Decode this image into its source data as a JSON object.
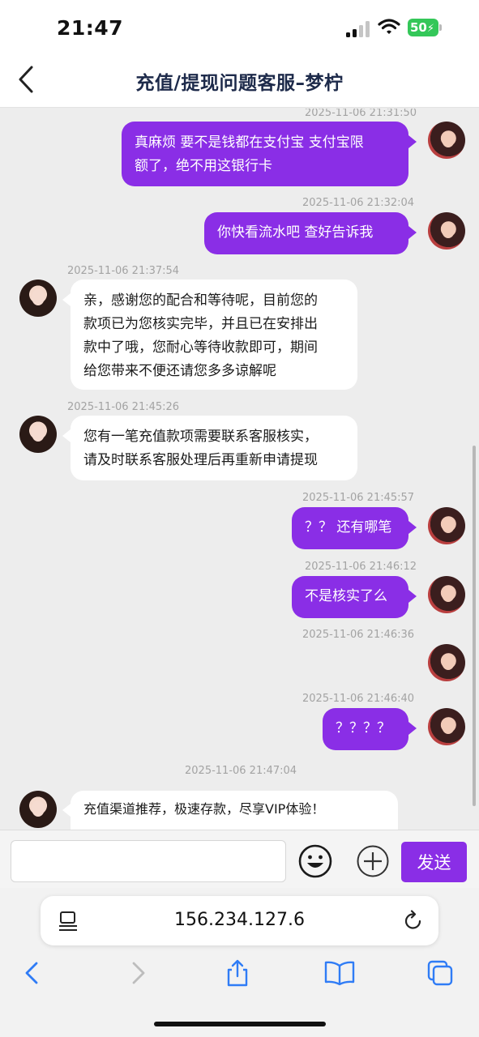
{
  "status_bar": {
    "time": "21:47",
    "battery": "50"
  },
  "header": {
    "title": "充值/提现问题客服–梦柠"
  },
  "colors": {
    "accent": "#8a2ee6",
    "title": "#1d2a4a",
    "battery": "#34c759"
  },
  "messages": [
    {
      "side": "right",
      "time": "2025-11-06 21:31:50",
      "lines": [
        "真麻烦 要不是钱都在支付宝 支付宝限",
        "额了，绝不用这银行卡"
      ]
    },
    {
      "side": "right",
      "time": "2025-11-06 21:32:04",
      "lines": [
        "你快看流水吧  查好告诉我"
      ]
    },
    {
      "side": "left",
      "time": "2025-11-06 21:37:54",
      "lines": [
        "亲，感谢您的配合和等待呢，目前您的",
        "款项已为您核实完毕，并且已在安排出",
        "款中了哦，您耐心等待收款即可，期间",
        "给您带来不便还请您多多谅解呢"
      ]
    },
    {
      "side": "left",
      "time": "2025-11-06 21:45:26",
      "lines": [
        "您有一笔充值款项需要联系客服核实，",
        "请及时联系客服处理后再重新申请提现"
      ]
    },
    {
      "side": "right",
      "time": "2025-11-06 21:45:57",
      "lines": [
        "？？ 还有哪笔"
      ]
    },
    {
      "side": "right",
      "time": "2025-11-06 21:46:12",
      "lines": [
        "不是核实了么"
      ]
    },
    {
      "side": "right",
      "time": "2025-11-06 21:46:36",
      "lines": []
    },
    {
      "side": "right",
      "time": "2025-11-06 21:46:40",
      "lines": [
        "？？？？"
      ]
    },
    {
      "side": "left",
      "time": "2025-11-06 21:47:04",
      "lines": [
        "充值渠道推荐，极速存款，尽享VIP体验！"
      ]
    }
  ],
  "input": {
    "value": "",
    "placeholder": "",
    "send_label": "发送"
  },
  "browser": {
    "url": "156.234.127.6"
  }
}
